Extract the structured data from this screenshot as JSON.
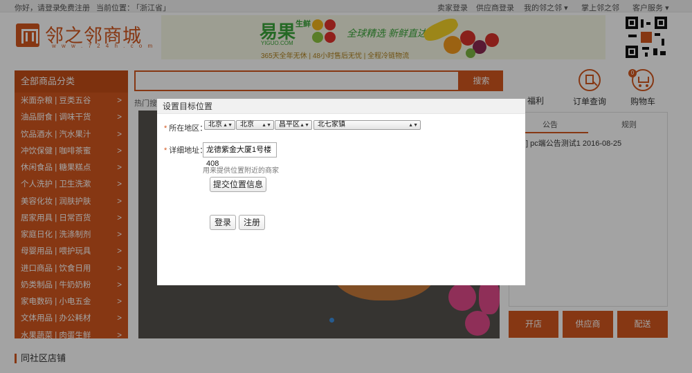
{
  "topbar": {
    "greeting": "你好，请登录",
    "register": "免费注册",
    "location_label": "当前位置：",
    "location_value": "「浙江省」",
    "buyer_login": "卖家登录",
    "supplier_login": "供应商登录",
    "my_account": "我的邻之邻",
    "mobile": "掌上邻之邻",
    "customer_service": "客户服务"
  },
  "logo": {
    "text": "邻之邻商城",
    "url": "w w w . 7 2 4 h . c o m"
  },
  "banner": {
    "brand": "易果",
    "brand_suffix": "生鲜",
    "brand_sub": "YIGUO.COM",
    "slogan": "全球精选 新鲜直达",
    "tagline": "365天全年无休 | 48小时售后无忧 | 全程冷链物流"
  },
  "sidebar": {
    "header": "全部商品分类",
    "arrow": ">",
    "items": [
      {
        "label": "米面杂粮 | 豆类五谷"
      },
      {
        "label": "油品厨食 | 调味干货"
      },
      {
        "label": "饮品酒水 | 汽水果汁"
      },
      {
        "label": "冲饮保健 | 咖啡茶蜜"
      },
      {
        "label": "休闲食品 | 糖果糕点"
      },
      {
        "label": "个人洗护 | 卫生洗漱"
      },
      {
        "label": "美容化妆 | 润肤护肤"
      },
      {
        "label": "居家用具 | 日常百货"
      },
      {
        "label": "家庭日化 | 洗涤制剂"
      },
      {
        "label": "母婴用品 | 喂护玩具"
      },
      {
        "label": "进口商品 | 饮食日用"
      },
      {
        "label": "奶类制品 | 牛奶奶粉"
      },
      {
        "label": "家电数码 | 小电五金"
      },
      {
        "label": "文体用品 | 办公耗材"
      },
      {
        "label": "水果蔬菜 | 肉蛋生鲜"
      }
    ]
  },
  "search": {
    "button": "搜索",
    "hot_label": "热门搜"
  },
  "right": {
    "welfare": "福利",
    "order_query": "订单查询",
    "cart": "购物车",
    "cart_count": "0",
    "notice_tab": "公告",
    "rules_tab": "规则",
    "notice_item": "] pc端公告测试1  2016-08-25"
  },
  "actions": {
    "open_store": "开店",
    "supplier": "供应商",
    "delivery": "配送"
  },
  "community": "同社区店铺",
  "modal": {
    "title": "设置目标位置",
    "region_label": "所在地区：",
    "required_mark": "*",
    "province": "北京",
    "city": "北京",
    "district": "昌平区",
    "town": "北七家镇",
    "address_label": "详细地址：",
    "address_value": "龙德紫金大厦1号楼408",
    "hint": "用来提供位置附近的商家",
    "submit": "提交位置信息",
    "login": "登录",
    "register": "注册"
  },
  "colors": {
    "brand": "#d2571f",
    "overlay": "rgba(0,0,0,0.36)",
    "banner_green": "#3aa43a"
  }
}
